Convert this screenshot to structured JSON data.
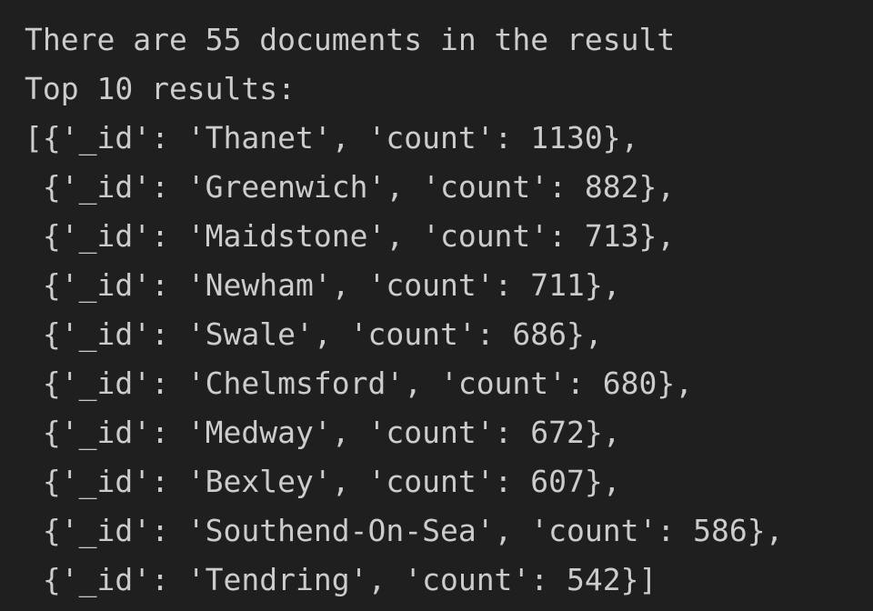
{
  "output": {
    "summary_line": "There are 55 documents in the result",
    "top_line": "Top 10 results:",
    "result_lines": [
      "[{'_id': 'Thanet', 'count': 1130},",
      " {'_id': 'Greenwich', 'count': 882},",
      " {'_id': 'Maidstone', 'count': 713},",
      " {'_id': 'Newham', 'count': 711},",
      " {'_id': 'Swale', 'count': 686},",
      " {'_id': 'Chelmsford', 'count': 680},",
      " {'_id': 'Medway', 'count': 672},",
      " {'_id': 'Bexley', 'count': 607},",
      " {'_id': 'Southend-On-Sea', 'count': 586},",
      " {'_id': 'Tendring', 'count': 542}]"
    ]
  }
}
